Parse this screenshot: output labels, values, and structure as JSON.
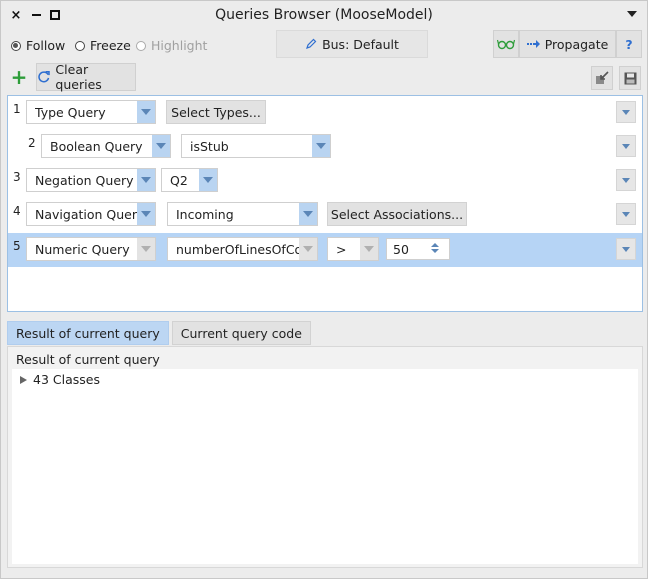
{
  "window": {
    "title": "Queries Browser (MooseModel)",
    "close_glyph": "×"
  },
  "toolbar": {
    "follow_label": "Follow",
    "freeze_label": "Freeze",
    "highlight_label": "Highlight",
    "bus_label": "Bus: Default",
    "propagate_label": "Propagate",
    "help_label": "?",
    "add_glyph": "+",
    "clear_label": "Clear queries",
    "selected_mode": "Follow"
  },
  "queries": [
    {
      "num": "1",
      "type": "Type Query",
      "button": "Select Types..."
    },
    {
      "num": "2",
      "type": "Boolean Query",
      "value": "isStub"
    },
    {
      "num": "3",
      "type": "Negation Query",
      "value": "Q2"
    },
    {
      "num": "4",
      "type": "Navigation Query",
      "value": "Incoming",
      "button": "Select Associations..."
    },
    {
      "num": "5",
      "type": "Numeric Query",
      "value": "numberOfLinesOfCode",
      "operator": ">",
      "number": "50"
    }
  ],
  "tabs": [
    "Result of current query",
    "Current query code"
  ],
  "result": {
    "label": "Result of current query",
    "items": [
      "43 Classes"
    ]
  },
  "colors": {
    "accent": "#b6d4f5",
    "dropdown_arrow": "#5b86b7",
    "add_icon": "#2e9d3a",
    "propagate_icon": "#2f6fd0"
  },
  "icons": [
    "close-icon",
    "minimize-icon",
    "maximize-icon",
    "refresh-icon",
    "pen-icon",
    "glasses-icon",
    "propagate-icon",
    "export-icon",
    "save-icon"
  ]
}
